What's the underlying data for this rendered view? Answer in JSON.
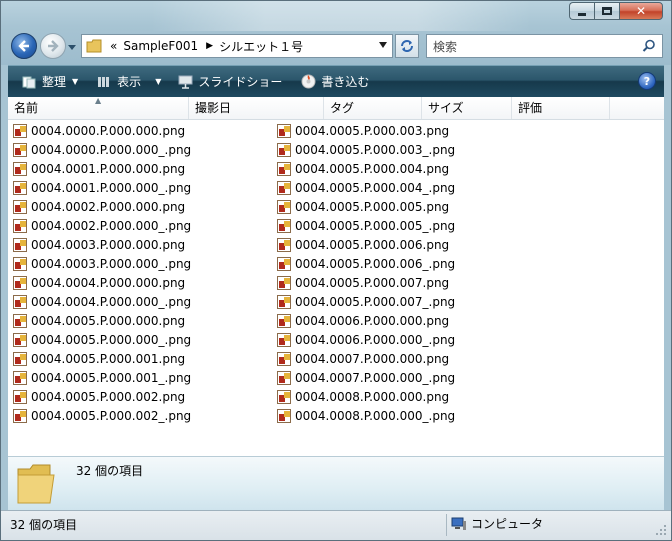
{
  "address": {
    "overflow": "«",
    "segments": [
      "SampleF001",
      "シルエット１号"
    ]
  },
  "search": {
    "placeholder": "検索"
  },
  "toolbar": {
    "organize_label": "整理",
    "view_label": "表示",
    "slideshow_label": "スライドショー",
    "burn_label": "書き込む",
    "help_label": "?"
  },
  "columns": {
    "name": "名前",
    "date_taken": "撮影日",
    "tags": "タグ",
    "size": "サイズ",
    "rating": "評価"
  },
  "files_col1": [
    "0004.0000.P.000.000.png",
    "0004.0000.P.000.000_.png",
    "0004.0001.P.000.000.png",
    "0004.0001.P.000.000_.png",
    "0004.0002.P.000.000.png",
    "0004.0002.P.000.000_.png",
    "0004.0003.P.000.000.png",
    "0004.0003.P.000.000_.png",
    "0004.0004.P.000.000.png",
    "0004.0004.P.000.000_.png",
    "0004.0005.P.000.000.png",
    "0004.0005.P.000.000_.png",
    "0004.0005.P.000.001.png",
    "0004.0005.P.000.001_.png",
    "0004.0005.P.000.002.png",
    "0004.0005.P.000.002_.png"
  ],
  "files_col2": [
    "0004.0005.P.000.003.png",
    "0004.0005.P.000.003_.png",
    "0004.0005.P.000.004.png",
    "0004.0005.P.000.004_.png",
    "0004.0005.P.000.005.png",
    "0004.0005.P.000.005_.png",
    "0004.0005.P.000.006.png",
    "0004.0005.P.000.006_.png",
    "0004.0005.P.000.007.png",
    "0004.0005.P.000.007_.png",
    "0004.0006.P.000.000.png",
    "0004.0006.P.000.000_.png",
    "0004.0007.P.000.000.png",
    "0004.0007.P.000.000_.png",
    "0004.0008.P.000.000.png",
    "0004.0008.P.000.000_.png"
  ],
  "details": {
    "item_count": "32 個の項目"
  },
  "status": {
    "item_count": "32 個の項目",
    "location": "コンピュータ"
  }
}
